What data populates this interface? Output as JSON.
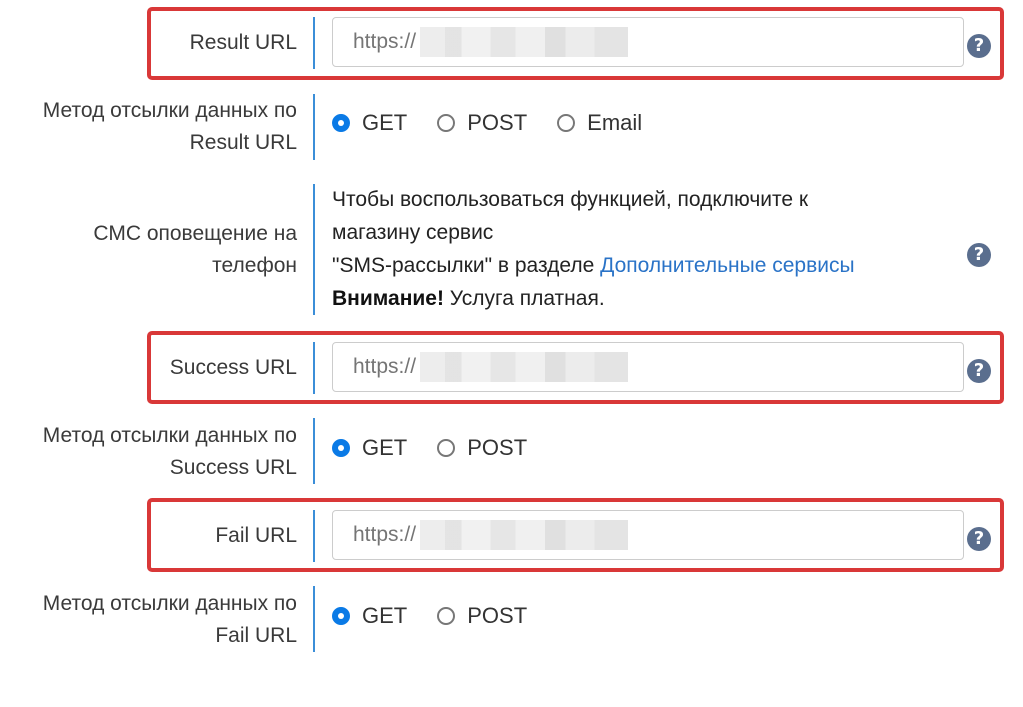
{
  "result_url": {
    "label": "Result URL",
    "value_prefix": "https://",
    "help_icon": "question-circle-icon"
  },
  "result_method": {
    "label_line1": "Метод отсылки данных по",
    "label_line2": "Result URL",
    "options": [
      "GET",
      "POST",
      "Email"
    ],
    "selected": "GET"
  },
  "sms": {
    "label_line1": "СМС оповещение на",
    "label_line2": "телефон",
    "text_line1": "Чтобы воспользоваться функцией, подключите к",
    "text_line2": "магазину сервис",
    "text_line3_prefix": "\"SMS-рассылки\" в разделе ",
    "link_text": "Дополнительные сервисы",
    "warning_bold": "Внимание!",
    "warning_rest": " Услуга платная.",
    "help_icon": "question-circle-icon"
  },
  "success_url": {
    "label": "Success URL",
    "value_prefix": "https://",
    "help_icon": "question-circle-icon"
  },
  "success_method": {
    "label_line1": "Метод отсылки данных по",
    "label_line2": "Success URL",
    "options": [
      "GET",
      "POST"
    ],
    "selected": "GET"
  },
  "fail_url": {
    "label": "Fail URL",
    "value_prefix": "https://",
    "help_icon": "question-circle-icon"
  },
  "fail_method": {
    "label_line1": "Метод отсылки данных по",
    "label_line2": "Fail URL",
    "options": [
      "GET",
      "POST"
    ],
    "selected": "GET"
  },
  "colors": {
    "highlight": "#d93838",
    "accent_bar": "#3b8ed8",
    "radio_checked": "#0a7ae6",
    "link": "#2a73c7",
    "help_icon": "#5a6e8e"
  }
}
